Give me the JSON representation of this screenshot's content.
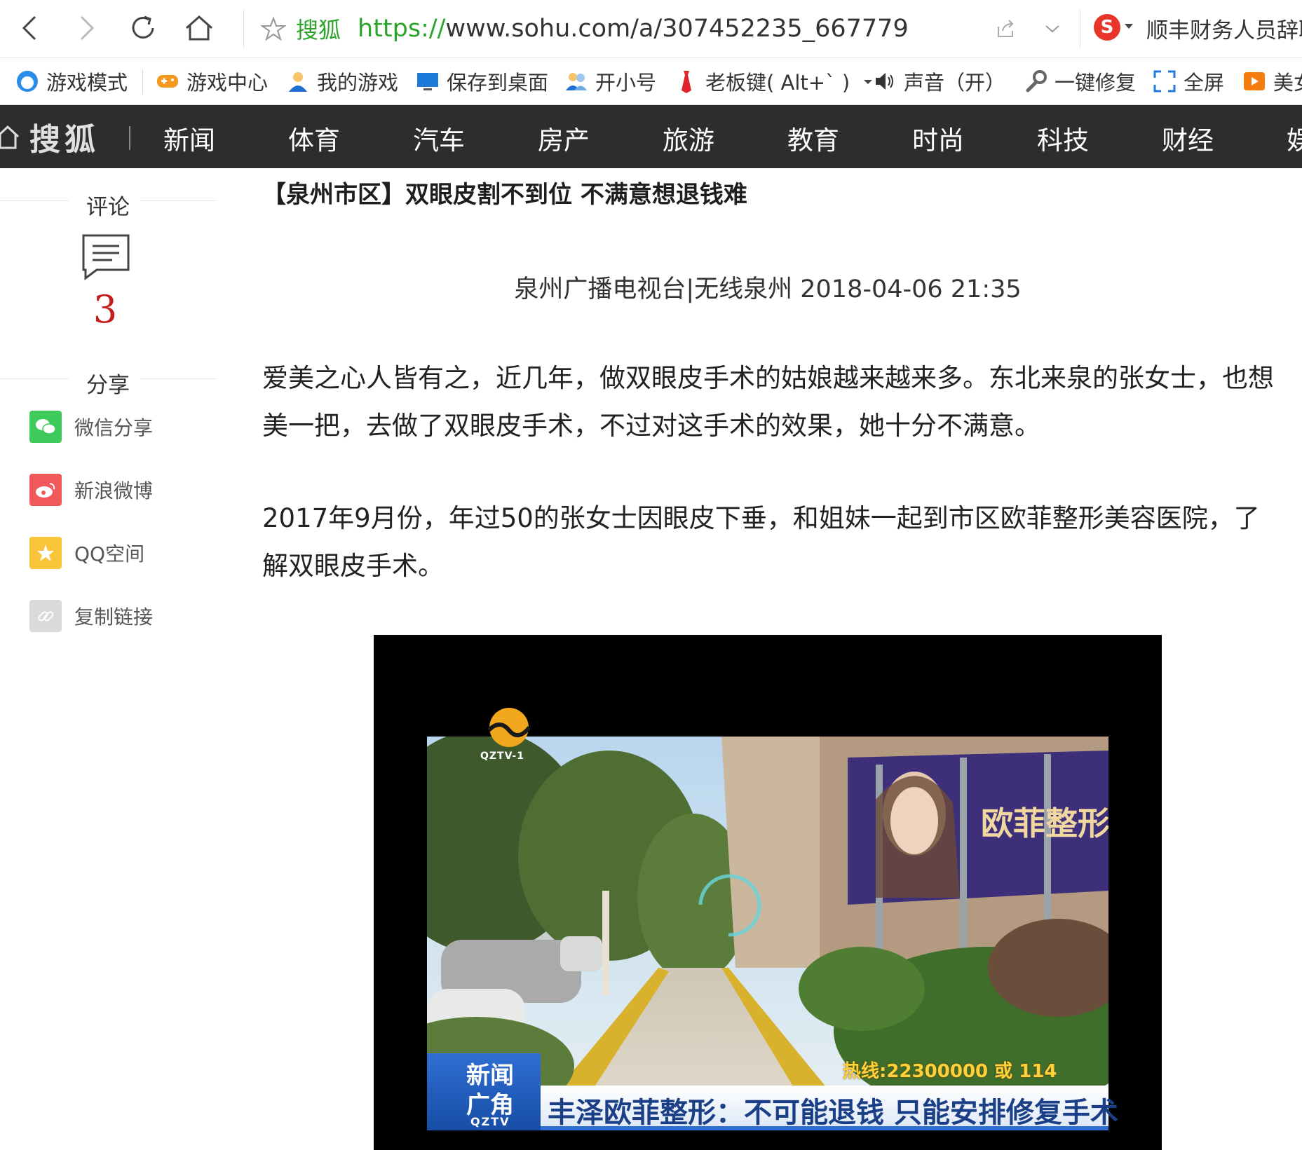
{
  "browser": {
    "site_name": "搜狐",
    "url_protocol": "https://",
    "url_rest": "www.sohu.com/a/307452235_667779",
    "news_ticker": "顺丰财务人员辞职"
  },
  "favorites": [
    {
      "label": "游戏模式",
      "icon": "game-mode-icon"
    },
    {
      "label": "游戏中心",
      "icon": "gamepad-icon"
    },
    {
      "label": "我的游戏",
      "icon": "user-icon"
    },
    {
      "label": "保存到桌面",
      "icon": "desktop-icon"
    },
    {
      "label": "开小号",
      "icon": "users-icon"
    },
    {
      "label": "老板键( Alt+` )",
      "icon": "boss-key-icon"
    },
    {
      "label": "声音（开）",
      "icon": "speaker-icon"
    },
    {
      "label": "一键修复",
      "icon": "wrench-icon"
    },
    {
      "label": "全屏",
      "icon": "fullscreen-icon"
    },
    {
      "label": "美女",
      "icon": "video-icon"
    }
  ],
  "site_nav": {
    "logo": "搜狐",
    "items": [
      "新闻",
      "体育",
      "汽车",
      "房产",
      "旅游",
      "教育",
      "时尚",
      "科技",
      "财经",
      "娱"
    ]
  },
  "sidebar": {
    "comment_label": "评论",
    "comment_count": "3",
    "share_label": "分享",
    "share_items": [
      {
        "label": "微信分享",
        "color": "#3fcb5b"
      },
      {
        "label": "新浪微博",
        "color": "#f0585c"
      },
      {
        "label": "QQ空间",
        "color": "#f9c43a"
      },
      {
        "label": "复制链接",
        "color": "#dadada"
      }
    ]
  },
  "article": {
    "title": "【泉州市区】双眼皮割不到位 不满意想退钱难",
    "meta": "泉州广播电视台|无线泉州 2018-04-06 21:35",
    "paragraphs": [
      "爱美之心人皆有之，近几年，做双眼皮手术的姑娘越来越来多。东北来泉的张女士，也想美一把，去做了双眼皮手术，不过对这手术的效果，她十分不满意。",
      "2017年9月份，年过50的张女士因眼皮下垂，和姐妹一起到市区欧菲整形美容医院，了解双眼皮手术。"
    ]
  },
  "video": {
    "channel_logo_text": "QZTV-1",
    "banner_news_line1": "新闻",
    "banner_news_line2": "广角",
    "banner_channel": "QZTV",
    "hotline": "热线:22300000 或 114",
    "headline": "丰泽欧菲整形：不可能退钱 只能安排修复手术",
    "storefront_sign": "欧菲整形"
  }
}
